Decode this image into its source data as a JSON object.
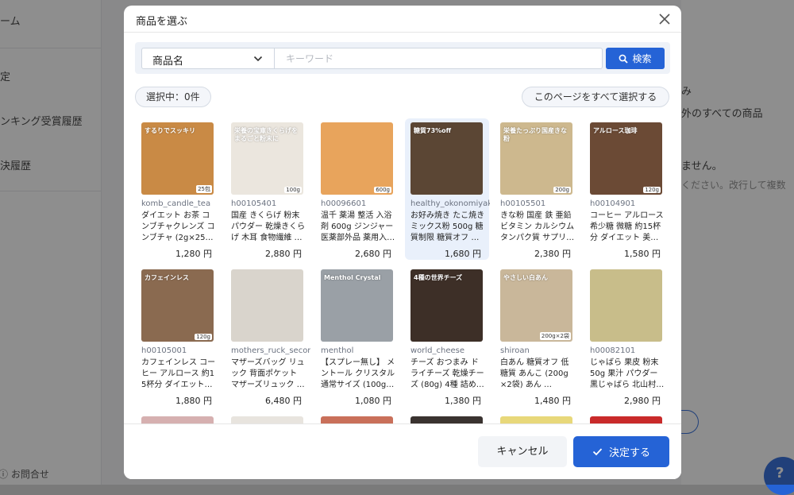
{
  "background": {
    "sidebar_items": [
      "ーム",
      "定",
      "ンキング受賞履歴",
      "決履歴"
    ],
    "contact_label": "お問合せ",
    "right_texts": [
      "み",
      "外のすべての商品",
      "ません。",
      "ください。改行して複数"
    ],
    "help_label": "?"
  },
  "modal": {
    "title": "商品を選ぶ",
    "search": {
      "field_value": "商品名",
      "keyword_placeholder": "キーワード",
      "button_label": "検索"
    },
    "selected_count": "選択中：0件",
    "select_all_label": "このページをすべて選択する",
    "products": [
      {
        "code": "komb_candle_tea",
        "name": "ダイエット お茶 コンブチャクレンズ コンブチャ (2g×25…",
        "price": "1,280 円",
        "img": "#c98a45",
        "label": "するりでスッキリ",
        "weight": "25包"
      },
      {
        "code": "h00105401",
        "name": "国産 きくらげ 粉末 パウダー 乾燥きくらげ 木耳 食物繊維 …",
        "price": "2,880 円",
        "img": "#ebe6de",
        "label": "栄養の宝庫きくらげをまるごと粉末に",
        "weight": "100g"
      },
      {
        "code": "h00096601",
        "name": "温千 薬湯 整活 入浴剤 600g ジンジャー 医薬部外品 薬用入…",
        "price": "2,680 円",
        "img": "#e8a45c",
        "label": "",
        "weight": "600g"
      },
      {
        "code": "healthy_okonomiyaki",
        "name": "お好み焼き たこ焼き ミックス粉 500g 糖質制限 糖質オフ …",
        "price": "1,680 円",
        "img": "#5b4634",
        "label": "糖質73%off",
        "weight": ""
      },
      {
        "code": "h00105501",
        "name": "きな粉 国産 鉄 亜鉛 ビタミン カルシウム タンパク質 サプリ…",
        "price": "2,380 円",
        "img": "#cdb88e",
        "label": "栄養たっぷり国産きな粉",
        "weight": "200g"
      },
      {
        "code": "h00104901",
        "name": "コーヒー アルロース 希少糖 微糖 約15杯分 ダイエット 美…",
        "price": "1,580 円",
        "img": "#6b4a35",
        "label": "アルロース珈琲",
        "weight": "120g"
      },
      {
        "code": "h00105001",
        "name": "カフェインレス コーヒー アルロース 約15杯分 ダイエット…",
        "price": "1,880 円",
        "img": "#8a6a50",
        "label": "カフェインレス",
        "weight": "120g"
      },
      {
        "code": "mothers_ruck_second",
        "name": "マザーズバッグ リュック 背面ポケット マザーズリュック …",
        "price": "6,480 円",
        "img": "#d9d4cc",
        "label": "",
        "weight": ""
      },
      {
        "code": "menthol",
        "name": "【スプレー無し】 メントール クリスタル 通常サイズ (100g) …",
        "price": "1,080 円",
        "img": "#9aa0a6",
        "label": "Menthol Crystal",
        "weight": ""
      },
      {
        "code": "world_cheese",
        "name": "チーズ おつまみ ドライチーズ 乾燥チーズ (80g) 4種 詰め…",
        "price": "1,380 円",
        "img": "#3d2f27",
        "label": "4種の世界チーズ",
        "weight": ""
      },
      {
        "code": "shiroan",
        "name": "白あん 糖質オフ 低糖質 あんこ (200g×2袋) あん …",
        "price": "1,480 円",
        "img": "#c9b79a",
        "label": "やさしい白あん",
        "weight": "200g×2袋"
      },
      {
        "code": "h00082101",
        "name": "じゃばら 果皮 粉末 50g 果汁 パウダー 黒じゃばら 北山村 …",
        "price": "2,980 円",
        "img": "#c8bd8a",
        "label": "",
        "weight": ""
      }
    ],
    "partial_row_colors": [
      "#d6b0b0",
      "#e8e4de",
      "#c9705a",
      "#3a3330",
      "#e8d87a",
      "#c92a2a"
    ],
    "cancel_label": "キャンセル",
    "confirm_label": "決定する"
  }
}
